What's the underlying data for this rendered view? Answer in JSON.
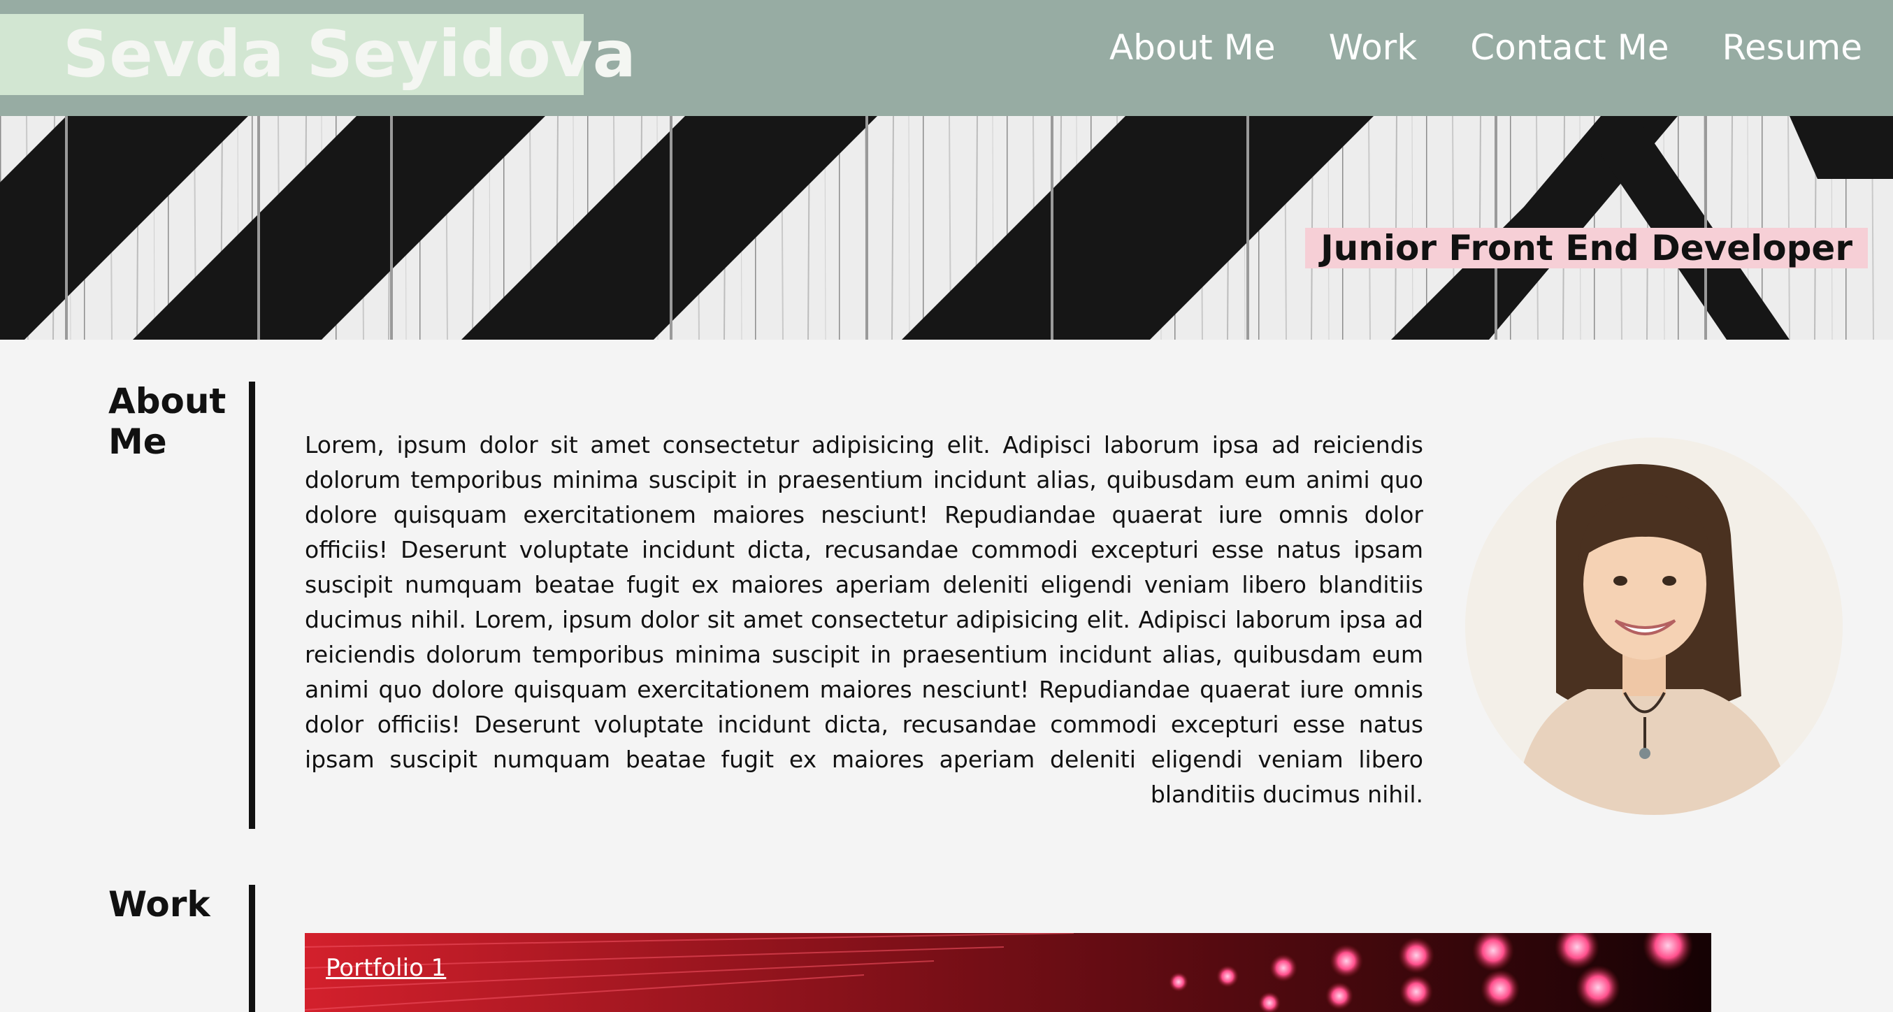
{
  "header": {
    "brand": "Sevda Seyidova",
    "nav": [
      "About Me",
      "Work",
      "Contact Me",
      "Resume"
    ]
  },
  "hero": {
    "tagline": "Junior Front End Developer"
  },
  "about": {
    "title": "About Me",
    "text": "Lorem, ipsum dolor sit amet consectetur adipisicing elit. Adipisci laborum ipsa ad reiciendis dolorum temporibus minima suscipit in praesentium incidunt alias, quibusdam eum animi quo dolore quisquam exercitationem maiores nesciunt! Repudiandae quaerat iure omnis dolor officiis! Deserunt voluptate incidunt dicta, recusandae commodi excepturi esse natus ipsam suscipit numquam beatae fugit ex maiores aperiam deleniti eligendi veniam libero blanditiis ducimus nihil. Lorem, ipsum dolor sit amet consectetur adipisicing elit. Adipisci laborum ipsa ad reiciendis dolorum temporibus minima suscipit in praesentium incidunt alias, quibusdam eum animi quo dolore quisquam exercitationem maiores nesciunt! Repudiandae quaerat iure omnis dolor officiis! Deserunt voluptate incidunt dicta, recusandae commodi excepturi esse natus ipsam suscipit numquam beatae fugit ex maiores aperiam deleniti eligendi veniam libero blanditiis ducimus nihil."
  },
  "work": {
    "title": "Work",
    "portfolio": [
      "Portfolio 1"
    ]
  },
  "colors": {
    "header_bg": "#97aca3",
    "brand_bg": "#d2e6d2",
    "tagline_bg": "#f6cfd6",
    "page_bg": "#f4f4f4"
  }
}
